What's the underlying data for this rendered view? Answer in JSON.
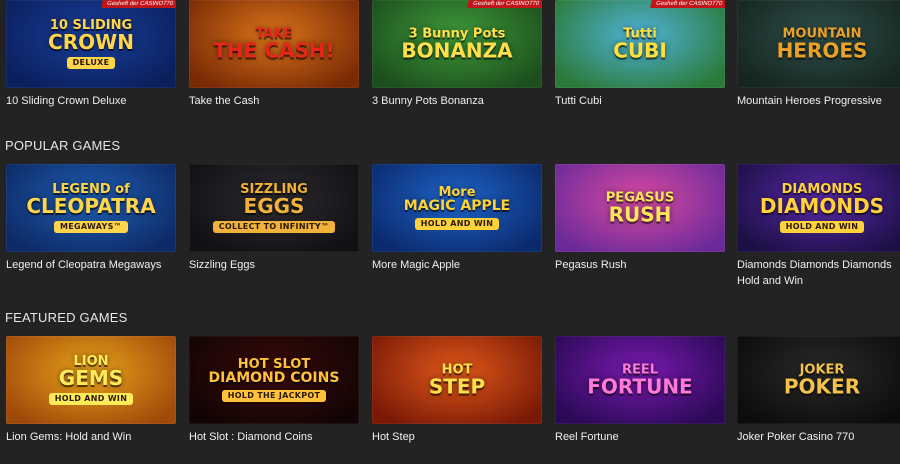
{
  "top_row": [
    {
      "name": "10 Sliding Crown Deluxe",
      "logo_line1": "10 SLIDING",
      "logo_line2": "CROWN",
      "badge": "DELUXE",
      "ribbon": "Gesheft der CASINO770",
      "colors": {
        "bg": "#1a3f9c",
        "bg2": "#0a1f5c",
        "text": "#ffd54a"
      }
    },
    {
      "name": "Take the Cash",
      "logo_line1": "TAKE",
      "logo_line2": "THE CASH!",
      "badge": "",
      "ribbon": "",
      "colors": {
        "bg": "#d9741a",
        "bg2": "#7a2a05",
        "text": "#e8251b"
      }
    },
    {
      "name": "3 Bunny Pots Bonanza",
      "logo_line1": "3 Bunny Pots",
      "logo_line2": "BONANZA",
      "badge": "",
      "ribbon": "Gesheft der CASINO770",
      "colors": {
        "bg": "#3f9a3a",
        "bg2": "#1c4f1d",
        "text": "#ffe04a"
      }
    },
    {
      "name": "Tutti Cubi",
      "logo_line1": "Tutti",
      "logo_line2": "CUBI",
      "badge": "",
      "ribbon": "Gesheft der CASINO770",
      "colors": {
        "bg": "#4fb3d8",
        "bg2": "#2b7a3a",
        "text": "#ffdf3a"
      }
    },
    {
      "name": "Mountain Heroes Progressive",
      "logo_line1": "MOUNTAIN",
      "logo_line2": "HEROES",
      "badge": "",
      "ribbon": "",
      "colors": {
        "bg": "#2f4f4a",
        "bg2": "#16251f",
        "text": "#e9a12a"
      }
    }
  ],
  "sections": [
    {
      "title": "POPULAR GAMES",
      "games": [
        {
          "name": "Legend of Cleopatra Megaways",
          "logo_line1": "LEGEND of",
          "logo_line2": "CLEOPATRA",
          "badge": "MEGAWAYS™",
          "colors": {
            "bg": "#1f5fb4",
            "bg2": "#0e2a66",
            "text": "#ffd54a"
          }
        },
        {
          "name": "Sizzling Eggs",
          "logo_line1": "SIZZLING",
          "logo_line2": "EGGS",
          "badge": "COLLECT TO INFINITY™",
          "colors": {
            "bg": "#2c2a2e",
            "bg2": "#111013",
            "text": "#f0b23a"
          }
        },
        {
          "name": "More Magic Apple",
          "logo_line1": "More",
          "logo_line2": "MAGIC APPLE",
          "badge": "HOLD AND WIN",
          "colors": {
            "bg": "#1e64c8",
            "bg2": "#0b2a6e",
            "text": "#ffd23a"
          }
        },
        {
          "name": "Pegasus Rush",
          "logo_line1": "PEGASUS",
          "logo_line2": "RUSH",
          "badge": "",
          "colors": {
            "bg": "#d84aa0",
            "bg2": "#6b2a9a",
            "text": "#ffe45a"
          }
        },
        {
          "name": "Diamonds Diamonds Diamonds Hold and Win",
          "logo_line1": "DIAMONDS",
          "logo_line2": "DIAMONDS",
          "badge": "HOLD AND WIN",
          "colors": {
            "bg": "#5a2aa8",
            "bg2": "#1c0f45",
            "text": "#ffd23a"
          }
        }
      ]
    },
    {
      "title": "FEATURED GAMES",
      "games": [
        {
          "name": "Lion Gems: Hold and Win",
          "logo_line1": "LION",
          "logo_line2": "GEMS",
          "badge": "HOLD AND WIN",
          "colors": {
            "bg": "#e8a21a",
            "bg2": "#a04a0a",
            "text": "#ffea5a"
          }
        },
        {
          "name": "Hot Slot : Diamond Coins",
          "logo_line1": "HOT SLOT",
          "logo_line2": "DIAMOND COINS",
          "badge": "HOLD THE JACKPOT",
          "colors": {
            "bg": "#3a0a0a",
            "bg2": "#120404",
            "text": "#ffc23a"
          }
        },
        {
          "name": "Hot Step",
          "logo_line1": "HOT",
          "logo_line2": "STEP",
          "badge": "",
          "colors": {
            "bg": "#e0581a",
            "bg2": "#7a1a06",
            "text": "#ffe04a"
          }
        },
        {
          "name": "Reel Fortune",
          "logo_line1": "REEL",
          "logo_line2": "FORTUNE",
          "badge": "",
          "colors": {
            "bg": "#7a1ab0",
            "bg2": "#2a0a55",
            "text": "#ff7ad8"
          }
        },
        {
          "name": "Joker Poker Casino 770",
          "logo_line1": "JOKER",
          "logo_line2": "POKER",
          "badge": "",
          "colors": {
            "bg": "#2a2a2a",
            "bg2": "#0c0c0c",
            "text": "#f2c24a"
          }
        }
      ]
    }
  ]
}
